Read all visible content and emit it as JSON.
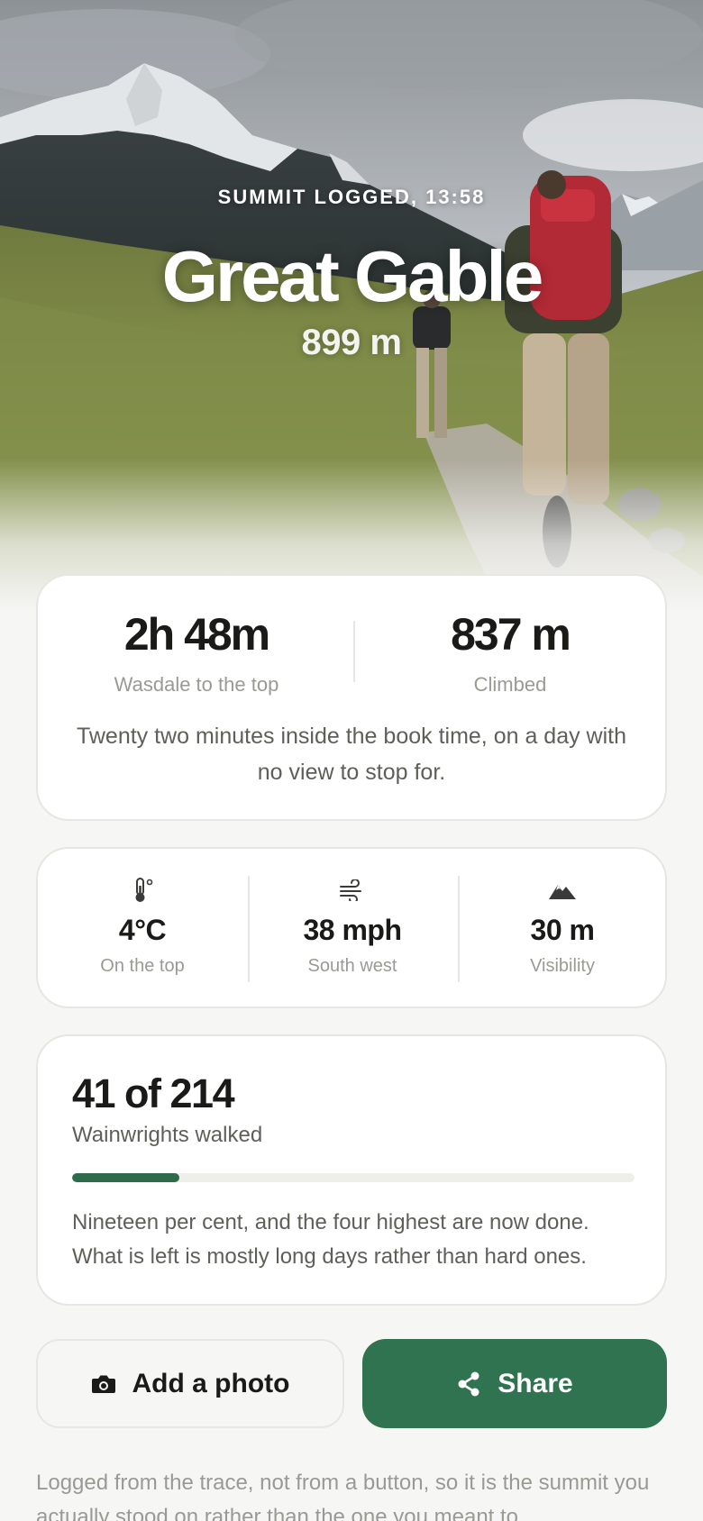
{
  "hero": {
    "kicker": "SUMMIT LOGGED, 13:58",
    "title": "Great Gable",
    "height": "899 m",
    "image": "hikers-on-mountain-trail"
  },
  "stats": {
    "time_value": "2h 48m",
    "time_label": "Wasdale to the top",
    "climb_value": "837 m",
    "climb_label": "Climbed",
    "note": "Twenty two minutes inside the book time, on a day with no view to stop for."
  },
  "weather": [
    {
      "icon": "thermometer-icon",
      "value": "4°C",
      "label": "On the top"
    },
    {
      "icon": "wind-icon",
      "value": "38 mph",
      "label": "South west"
    },
    {
      "icon": "mountain-icon",
      "value": "30 m",
      "label": "Visibility"
    }
  ],
  "progress": {
    "count": "41 of 214",
    "label": "Wainwrights walked",
    "fraction": 0.19,
    "note": "Nineteen per cent, and the four highest are now done. What is left is mostly long days rather than hard ones."
  },
  "actions": {
    "photo_label": "Add a photo",
    "photo_icon": "camera-icon",
    "share_label": "Share",
    "share_icon": "share-icon"
  },
  "footer": {
    "note": "Logged from the trace, not from a button, so it is the summit you actually stood on rather than the one you meant to."
  },
  "colors": {
    "accent": "#2f7350",
    "progress_fill": "#2d6b4a",
    "background": "#f6f6f4"
  }
}
